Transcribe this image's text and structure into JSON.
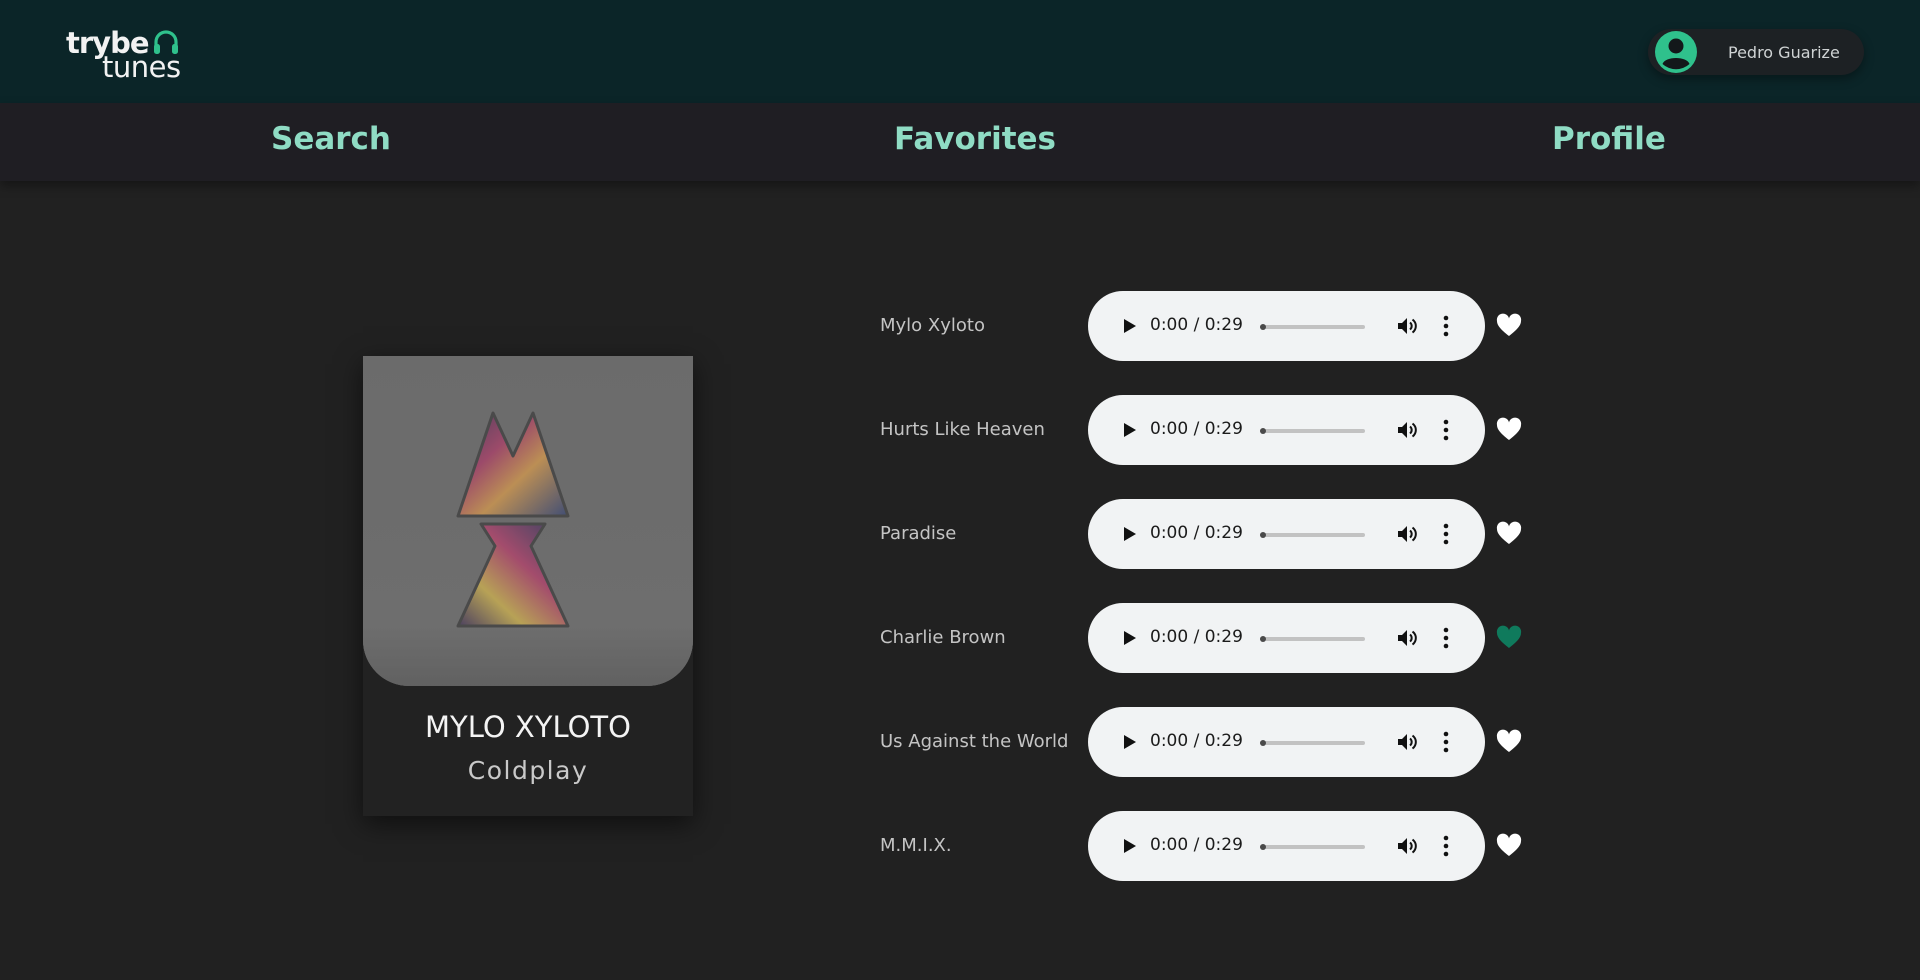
{
  "header": {
    "logo_top": "trybe",
    "logo_bottom": "tunes",
    "user_name": "Pedro Guarize"
  },
  "nav": {
    "search": "Search",
    "favorites": "Favorites",
    "profile": "Profile"
  },
  "album": {
    "name": "MYLO XYLOTO",
    "artist": "Coldplay"
  },
  "tracks": [
    {
      "name": "Mylo Xyloto",
      "time": "0:00 / 0:29",
      "progress": 0,
      "favorite": false
    },
    {
      "name": "Hurts Like Heaven",
      "time": "0:00 / 0:29",
      "progress": 0,
      "favorite": false
    },
    {
      "name": "Paradise",
      "time": "0:00 / 0:29",
      "progress": 0,
      "favorite": false
    },
    {
      "name": "Charlie Brown",
      "time": "0:00 / 0:29",
      "progress": 0,
      "favorite": true
    },
    {
      "name": "Us Against the World",
      "time": "0:00 / 0:29",
      "progress": 0,
      "favorite": false
    },
    {
      "name": "M.M.I.X.",
      "time": "0:00 / 0:29",
      "progress": 0,
      "favorite": false
    }
  ],
  "icons": {
    "logo": "headphones-icon",
    "avatar": "user-avatar-icon",
    "play": "play-icon",
    "volume": "volume-icon",
    "more": "more-vertical-icon",
    "heart": "heart-icon"
  },
  "colors": {
    "accent": "#2fc18c",
    "nav_text": "#8fdcc4",
    "favorite_active": "#0f7a5c",
    "favorite_inactive": "#ffffff"
  }
}
